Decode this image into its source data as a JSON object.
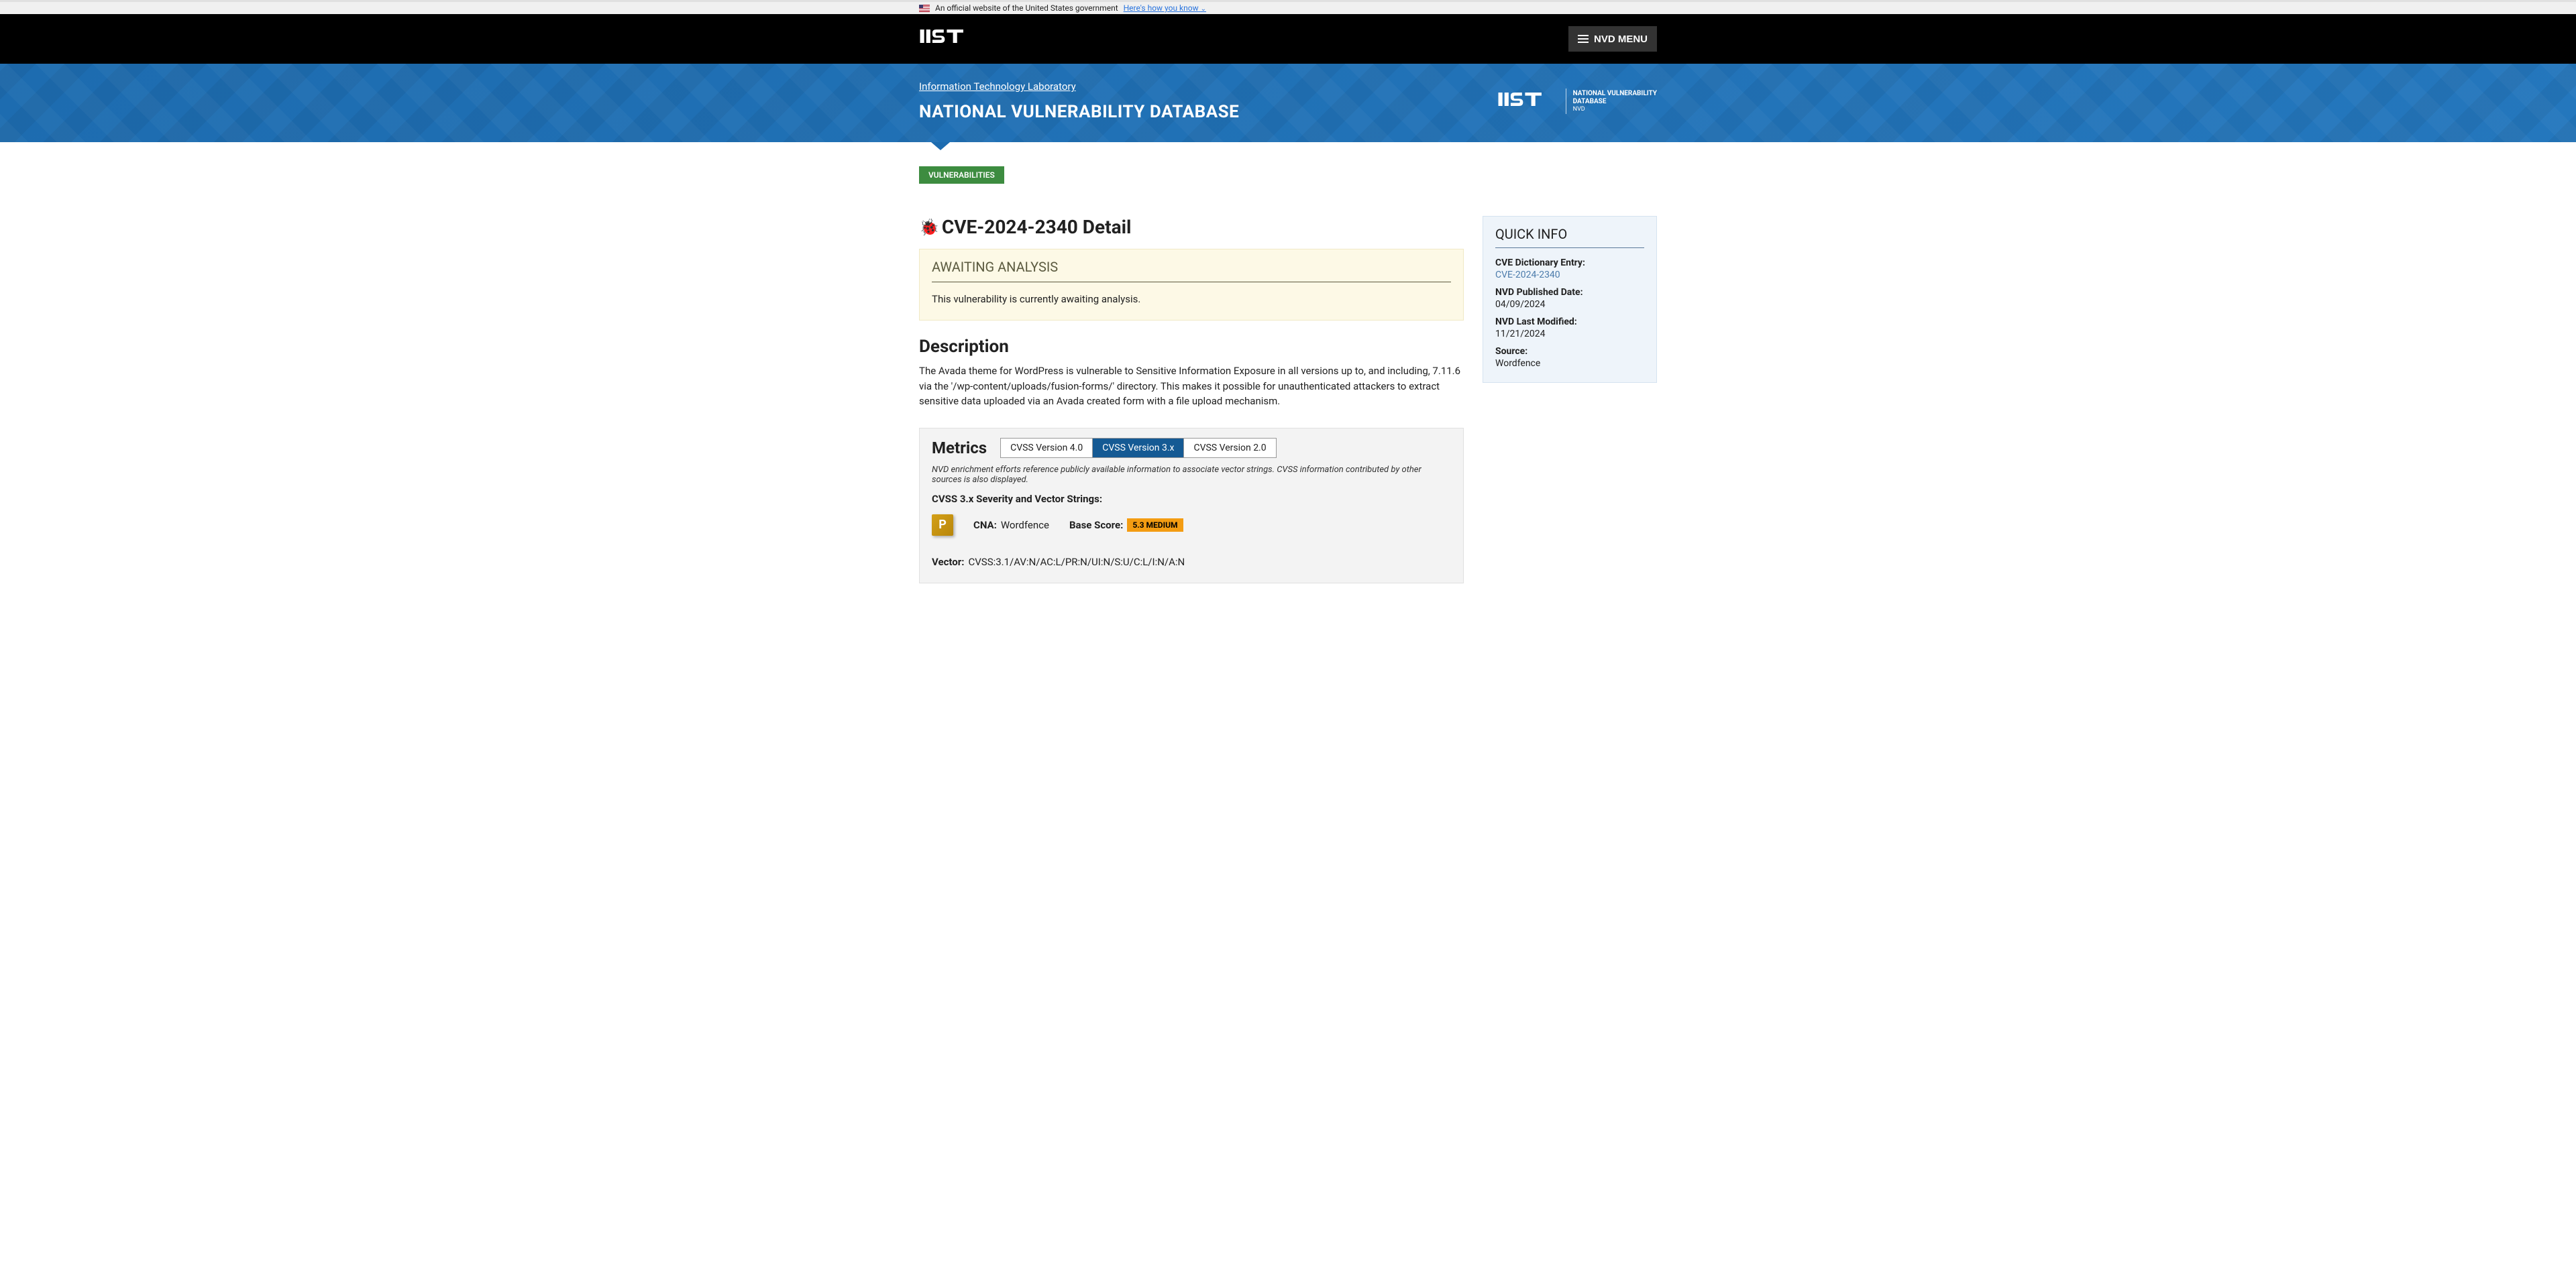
{
  "gov_banner": {
    "text": "An official website of the United States government",
    "link_text": "Here's how you know"
  },
  "header": {
    "menu_button": "NVD MENU"
  },
  "blue_banner": {
    "lab_link": "Information Technology Laboratory",
    "nvd_title": "NATIONAL VULNERABILITY DATABASE",
    "logo_line1": "NATIONAL VULNERABILITY",
    "logo_line2": "DATABASE",
    "logo_sub": "NVD"
  },
  "badge": "VULNERABILITIES",
  "page_title": "CVE-2024-2340 Detail",
  "status": {
    "title": "AWAITING ANALYSIS",
    "text": "This vulnerability is currently awaiting analysis."
  },
  "description": {
    "heading": "Description",
    "text": "The Avada theme for WordPress is vulnerable to Sensitive Information Exposure in all versions up to, and including, 7.11.6 via the '/wp-content/uploads/fusion-forms/' directory. This makes it possible for unauthenticated attackers to extract sensitive data uploaded via an Avada created form with a file upload mechanism."
  },
  "metrics": {
    "heading": "Metrics",
    "tabs": [
      "CVSS Version 4.0",
      "CVSS Version 3.x",
      "CVSS Version 2.0"
    ],
    "active_tab_index": 1,
    "note": "NVD enrichment efforts reference publicly available information to associate vector strings. CVSS information contributed by other sources is also displayed.",
    "severity_title": "CVSS 3.x Severity and Vector Strings:",
    "provider_icon_letter": "P",
    "cna_label": "CNA:",
    "cna_value": "Wordfence",
    "base_score_label": "Base Score:",
    "base_score_value": "5.3 MEDIUM",
    "vector_label": "Vector:",
    "vector_value": "CVSS:3.1/AV:N/AC:L/PR:N/UI:N/S:U/C:L/I:N/A:N"
  },
  "quickinfo": {
    "title": "QUICK INFO",
    "entries": [
      {
        "label": "CVE Dictionary Entry:",
        "value": "CVE-2024-2340",
        "is_link": true
      },
      {
        "label": "NVD Published Date:",
        "value": "04/09/2024",
        "is_link": false
      },
      {
        "label": "NVD Last Modified:",
        "value": "11/21/2024",
        "is_link": false
      },
      {
        "label": "Source:",
        "value": "Wordfence",
        "is_link": false
      }
    ]
  }
}
